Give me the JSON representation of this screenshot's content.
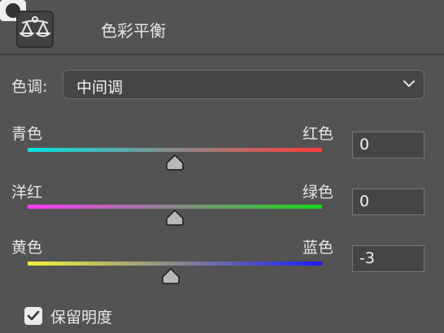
{
  "panel": {
    "title": "色彩平衡",
    "balance_icon": "balance-scale-icon",
    "mask_icon": "mask-icon"
  },
  "tone": {
    "label": "色调:",
    "selected": "中间调"
  },
  "sliders": [
    {
      "left_label": "青色",
      "right_label": "红色",
      "value": "0",
      "min": -100,
      "max": 100,
      "gradient": [
        "#00e5e5",
        "#ff3b3b"
      ]
    },
    {
      "left_label": "洋红",
      "right_label": "绿色",
      "value": "0",
      "min": -100,
      "max": 100,
      "gradient": [
        "#ff3cff",
        "#18d918"
      ]
    },
    {
      "left_label": "黄色",
      "right_label": "蓝色",
      "value": "-3",
      "min": -100,
      "max": 100,
      "gradient": [
        "#f2f23a",
        "#1a1aff"
      ]
    }
  ],
  "preserve_luminosity": {
    "label": "保留明度",
    "checked": true
  }
}
